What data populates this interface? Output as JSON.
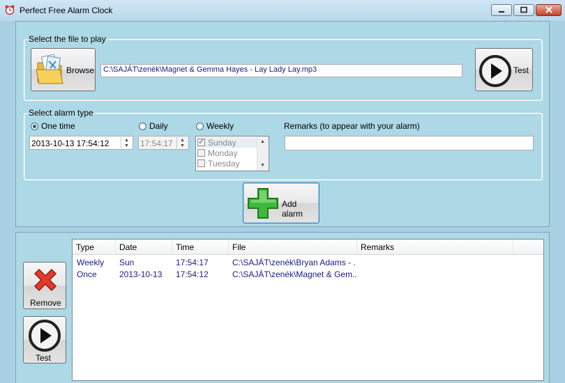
{
  "window": {
    "title": "Perfect Free Alarm Clock",
    "icon": "alarm-clock-icon",
    "controls": [
      "minimize-icon",
      "maximize-icon",
      "close-icon"
    ]
  },
  "file_group": {
    "legend": "Select the file to play",
    "browse_label": "Browse",
    "file_path": "C:\\SAJÁT\\zenék\\Magnet & Gemma Hayes - Lay Lady Lay.mp3",
    "test_label": "Test"
  },
  "alarm_group": {
    "legend": "Select alarm type",
    "one_time_label": "One time",
    "daily_label": "Daily",
    "weekly_label": "Weekly",
    "selected_type": "One time",
    "one_time_value": "2013-10-13 17:54:12",
    "daily_value": "17:54:17",
    "days": [
      {
        "label": "Sunday",
        "checked": true
      },
      {
        "label": "Monday",
        "checked": false
      },
      {
        "label": "Tuesday",
        "checked": false
      }
    ],
    "remarks_label": "Remarks (to appear with your alarm)",
    "remarks_value": ""
  },
  "add_alarm_label": "Add alarm",
  "remove_label": "Remove",
  "test2_label": "Test",
  "alarms_table": {
    "columns": [
      "Type",
      "Date",
      "Time",
      "File",
      "Remarks"
    ],
    "rows": [
      [
        "Weekly",
        "Sun",
        "17:54:17",
        "C:\\SAJÁT\\zenék\\Bryan Adams - ...",
        ""
      ],
      [
        "Once",
        "2013-10-13",
        "17:54:12",
        "C:\\SAJÁT\\zenék\\Magnet & Gem...",
        ""
      ]
    ]
  },
  "colors": {
    "background": "#a9cfe2",
    "panel": "#add8e6",
    "list_text": "#1a1a8a"
  }
}
